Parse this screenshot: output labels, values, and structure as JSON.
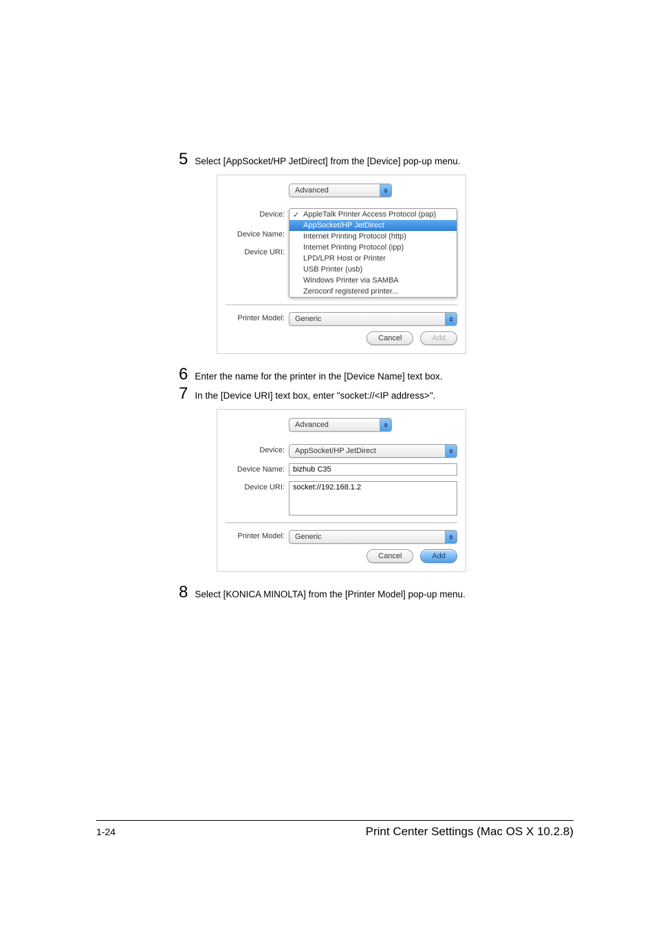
{
  "steps": {
    "s5": {
      "num": "5",
      "text": "Select [AppSocket/HP JetDirect] from the [Device] pop-up menu."
    },
    "s6": {
      "num": "6",
      "text": "Enter the name for the printer in the [Device Name] text box."
    },
    "s7": {
      "num": "7",
      "text": "In the [Device URI] text box, enter \"socket://<IP address>\"."
    },
    "s8": {
      "num": "8",
      "text": "Select [KONICA MINOLTA] from the [Printer Model] pop-up menu."
    }
  },
  "shot1": {
    "top_popup": "Advanced",
    "labels": {
      "device": "Device:",
      "device_name": "Device Name:",
      "device_uri": "Device URI:",
      "printer_model": "Printer Model:"
    },
    "menu": {
      "checked": "AppleTalk Printer Access Protocol (pap)",
      "hilite": "AppSocket/HP JetDirect",
      "items": [
        "Internet Printing Protocol (http)",
        "Internet Printing Protocol (ipp)",
        "LPD/LPR Host or Printer",
        "USB Printer (usb)",
        "Windows Printer via SAMBA",
        "Zeroconf registered printer..."
      ]
    },
    "printer_model": "Generic",
    "buttons": {
      "cancel": "Cancel",
      "add": "Add"
    }
  },
  "shot2": {
    "top_popup": "Advanced",
    "labels": {
      "device": "Device:",
      "device_name": "Device Name:",
      "device_uri": "Device URI:",
      "printer_model": "Printer Model:"
    },
    "device_value": "AppSocket/HP JetDirect",
    "device_name_value": "bizhub C35",
    "device_uri_value": "socket://192.168.1.2",
    "printer_model": "Generic",
    "buttons": {
      "cancel": "Cancel",
      "add": "Add"
    }
  },
  "footer": {
    "page": "1-24",
    "title": "Print Center Settings (Mac OS X 10.2.8)"
  }
}
